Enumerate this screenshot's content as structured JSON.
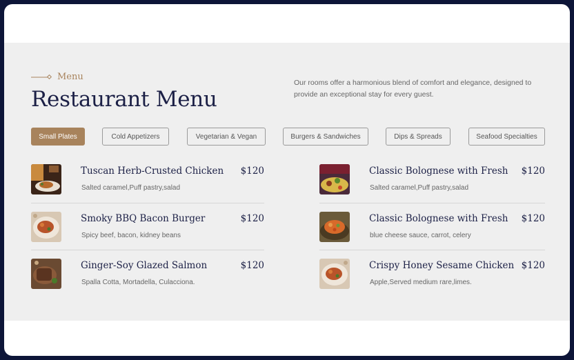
{
  "section": {
    "eyebrow": "Menu",
    "title": "Restaurant Menu",
    "intro": "Our rooms offer a harmonious blend of comfort and elegance, designed to provide an exceptional stay for every guest."
  },
  "tabs": [
    {
      "label": "Small Plates",
      "active": true
    },
    {
      "label": "Cold Appetizers",
      "active": false
    },
    {
      "label": "Vegetarian & Vegan",
      "active": false
    },
    {
      "label": "Burgers & Sandwiches",
      "active": false
    },
    {
      "label": "Dips & Spreads",
      "active": false
    },
    {
      "label": "Seafood Specialties",
      "active": false
    }
  ],
  "items": [
    {
      "name": "Tuscan Herb-Crusted Chicken",
      "price": "$120",
      "desc": "Salted caramel,Puff pastry,salad"
    },
    {
      "name": "Classic Bolognese with Fresh",
      "price": "$120",
      "desc": "Salted caramel,Puff pastry,salad"
    },
    {
      "name": "Smoky BBQ Bacon Burger",
      "price": "$120",
      "desc": "Spicy beef, bacon, kidney beans"
    },
    {
      "name": "Classic Bolognese with Fresh",
      "price": "$120",
      "desc": "blue cheese sauce, carrot, celery"
    },
    {
      "name": "Ginger-Soy Glazed Salmon",
      "price": "$120",
      "desc": "Spalla Cotta, Mortadella, Culacciona."
    },
    {
      "name": "Crispy Honey Sesame Chicken",
      "price": "$120",
      "desc": "Apple,Served medium rare,limes."
    }
  ],
  "colors": {
    "accent": "#a8835c",
    "heading": "#1c2046",
    "section_bg": "#efefef",
    "outer_bg": "#0d1538"
  }
}
